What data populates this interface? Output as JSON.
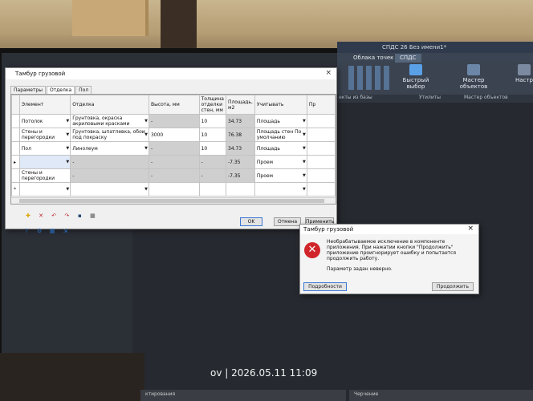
{
  "ribbon": {
    "app_title": "СПДС 26 Без имени1*",
    "tabs": [
      "Облака точек",
      "СПДС"
    ],
    "buttons": [
      "Быстрый выбор",
      "Мастер объектов",
      "Настро"
    ],
    "groups": [
      "екты из базы",
      "Утилиты",
      "Мастер объектов"
    ]
  },
  "dialog": {
    "title": "Тамбур грузовой",
    "tabs": [
      "Параметры",
      "Отделка",
      "Пол"
    ],
    "columns": [
      "Элемент",
      "Отделка",
      "Высота, мм",
      "Толщина отделки стен, мм",
      "Площадь, м2",
      "Учитывать",
      "Пр"
    ],
    "rows": [
      {
        "element": "Потолок",
        "finish": "Грунтовка, окраска акриловыми красками",
        "height": "-",
        "thickness": "10",
        "area": "34.73",
        "count": "Площадь"
      },
      {
        "element": "Стены и перегородки",
        "finish": "Грунтовка, шпатлевка, обои под покраску",
        "height": "3000",
        "thickness": "10",
        "area": "76.38",
        "count": "Площадь стен По умолчанию"
      },
      {
        "element": "Пол",
        "finish": "Линолеум",
        "height": "-",
        "thickness": "10",
        "area": "34.73",
        "count": "Площадь"
      },
      {
        "element": "",
        "finish": "-",
        "height": "-",
        "thickness": "-",
        "area": "-7.35",
        "count": "Проем"
      },
      {
        "element": "Стены и перегородки",
        "finish": "-",
        "height": "-",
        "thickness": "-",
        "area": "-7.35",
        "count": "Проем"
      },
      {
        "element": "",
        "finish": "",
        "height": "",
        "thickness": "",
        "area": "",
        "count": ""
      }
    ],
    "buttons": {
      "ok": "OK",
      "cancel": "Отмена",
      "apply": "Применить"
    }
  },
  "error": {
    "title": "Тамбур грузовой",
    "message": "Необрабатываемое исключение в компоненте приложения. При нажатии кнопки \"Продолжить\" приложение проигнорирует ошибку и попытается продолжить работу.",
    "param": "Параметр задан неверно.",
    "details_button": "Подробности",
    "continue_button": "Продолжить"
  },
  "overlay": {
    "stamp": "ov | 2026.05.11 11:09"
  },
  "taskbar": [
    "ктирования",
    "Черчение"
  ]
}
